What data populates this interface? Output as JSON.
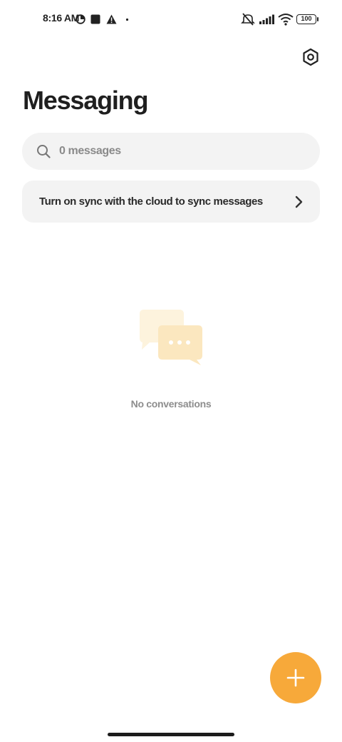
{
  "status_bar": {
    "time": "8:16 AM",
    "battery": "100",
    "icons": [
      "data-saver-icon",
      "square-notification-icon",
      "warning-icon",
      "dot-icon",
      "mute-icon",
      "signal-icon",
      "wifi-icon",
      "battery-icon"
    ]
  },
  "header": {
    "title": "Messaging",
    "settings_icon": "settings-hexagon-icon"
  },
  "search": {
    "placeholder": "0 messages",
    "icon": "search-icon"
  },
  "sync_banner": {
    "text": "Turn on sync with the cloud to sync messages",
    "icon": "chevron-right-icon"
  },
  "empty_state": {
    "icon": "chat-bubbles-icon",
    "text": "No conversations"
  },
  "fab": {
    "icon": "plus-icon"
  },
  "colors": {
    "accent": "#f7a93a",
    "card_background": "#f3f3f3",
    "title": "#1f1f1f",
    "muted_text": "#8d8d8d",
    "illustration_light": "#fdf3dd",
    "illustration_medium": "#fbe7bf"
  }
}
